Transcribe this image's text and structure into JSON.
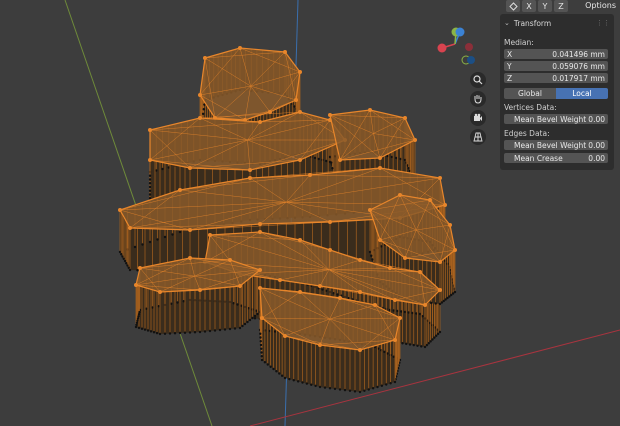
{
  "header": {
    "buttons": [
      {
        "name": "overlay-toggle-icon",
        "label": ""
      },
      {
        "name": "mirror-x-button",
        "label": "X"
      },
      {
        "name": "mirror-y-button",
        "label": "Y"
      },
      {
        "name": "mirror-z-button",
        "label": "Z"
      }
    ],
    "options_label": "Options"
  },
  "gizmo": {
    "axis_x": "X",
    "axis_y": "Y",
    "axis_z": "Z",
    "x_color": "#d9434f",
    "y_color": "#8bb446",
    "z_color": "#3b82d4"
  },
  "tools": [
    "zoom-icon",
    "hand-pan-icon",
    "camera-icon",
    "grid-perspective-icon"
  ],
  "panel": {
    "title": "Transform",
    "median_label": "Median:",
    "x_key": "X",
    "x_val": "0.041496 mm",
    "y_key": "Y",
    "y_val": "0.059076 mm",
    "z_key": "Z",
    "z_val": "0.017917 mm",
    "global_label": "Global",
    "local_label": "Local",
    "vertices_label": "Vertices Data:",
    "mbw_v_key": "Mean Bevel Weight",
    "mbw_v_val": "0.00",
    "edges_label": "Edges Data:",
    "mbw_e_key": "Mean Bevel Weight",
    "mbw_e_val": "0.00",
    "crease_key": "Mean Crease",
    "crease_val": "0.00"
  },
  "colors": {
    "background": "#3d3d3d",
    "selection": "#e8862b",
    "panel": "#2d2d2d",
    "active": "#4772b3"
  }
}
